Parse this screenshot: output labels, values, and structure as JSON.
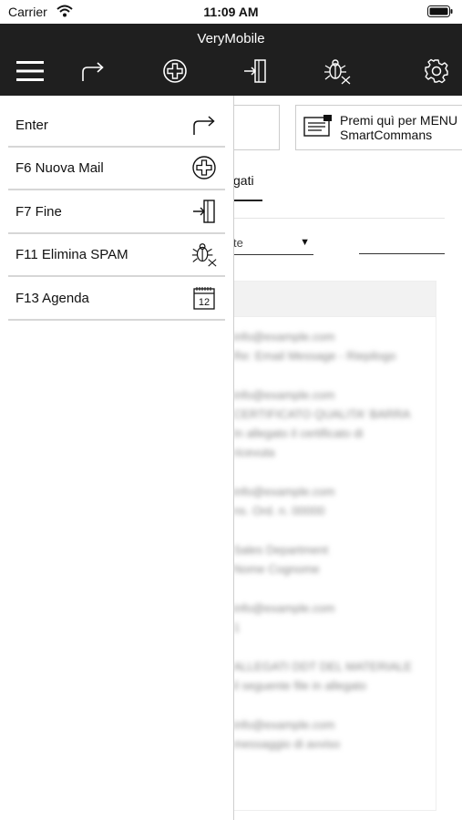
{
  "status_bar": {
    "carrier": "Carrier",
    "time": "11:09 AM"
  },
  "app_bar": {
    "title": "VeryMobile",
    "toolbar": [
      {
        "name": "menu-icon"
      },
      {
        "name": "enter-arrow-icon"
      },
      {
        "name": "new-mail-plus-icon"
      },
      {
        "name": "exit-door-icon"
      },
      {
        "name": "bug-spam-icon"
      },
      {
        "name": "gear-icon"
      }
    ]
  },
  "background": {
    "menu_button_label": "Premi quì per MENU\nSmartCommans",
    "tab_label": "gati",
    "select_value": "te",
    "list_rows": [
      [
        "info@example.com",
        "Re: Email Message - Riepilogo"
      ],
      [
        "info@example.com",
        "CERTIFICATO QUALITA' BARRA",
        "In allegato il certificato di",
        "ricevuta"
      ],
      [
        "info@example.com",
        "ns. Ord. n. 00000"
      ],
      [
        "Sales Department",
        "Nome Cognome"
      ],
      [
        "info@example.com",
        "1"
      ],
      [
        "ALLEGATI DDT DEL MATERIALE",
        "il seguente file in allegato"
      ],
      [
        "info@example.com",
        "messaggio di avviso"
      ]
    ]
  },
  "side_menu": {
    "items": [
      {
        "label": "Enter",
        "icon": "enter-arrow-icon"
      },
      {
        "label": "F6 Nuova Mail",
        "icon": "new-mail-plus-icon"
      },
      {
        "label": "F7 Fine",
        "icon": "exit-door-icon"
      },
      {
        "label": "F11 Elimina SPAM",
        "icon": "bug-spam-icon"
      },
      {
        "label": "F13 Agenda",
        "icon": "calendar-icon",
        "icon_text": "12"
      }
    ]
  },
  "colors": {
    "app_bar_bg": "#1f1f1f",
    "menu_divider": "#d6d6d6"
  }
}
